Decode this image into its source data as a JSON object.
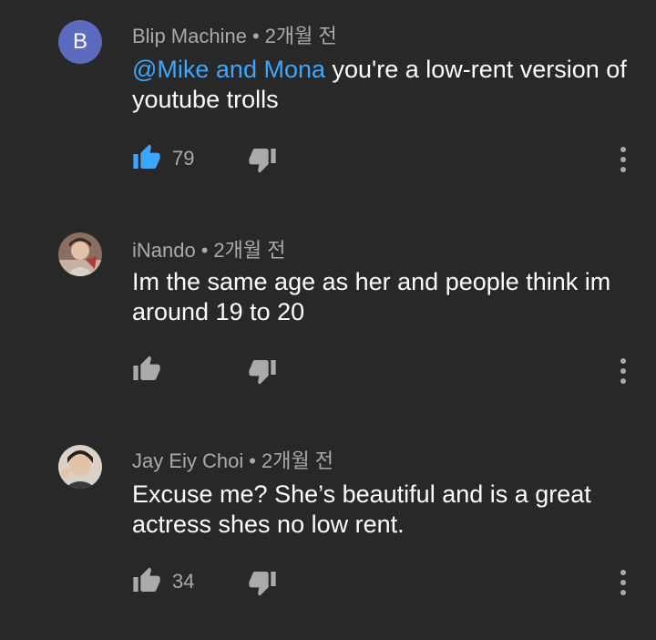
{
  "colors": {
    "background": "#282828",
    "mention": "#3ea6ff",
    "liked": "#3ea6ff",
    "muted": "#aaaaaa",
    "avatar_b": "#5c6bc0"
  },
  "comments": [
    {
      "author": "Blip Machine",
      "separator": "•",
      "time": "2개월 전",
      "avatar_letter": "B",
      "mention": "@Mike and Mona",
      "text": " you're a low-rent version of youtube trolls",
      "likes": "79",
      "liked": true,
      "like_icon": "thumbs-up-icon",
      "dislike_icon": "thumbs-down-icon",
      "menu_icon": "more-vert-icon"
    },
    {
      "author": "iNando",
      "separator": "•",
      "time": "2개월 전",
      "text": "Im the same age as her and people think im around 19 to 20",
      "likes": "",
      "liked": false,
      "like_icon": "thumbs-up-icon",
      "dislike_icon": "thumbs-down-icon",
      "menu_icon": "more-vert-icon"
    },
    {
      "author": "Jay Eiy Choi",
      "separator": "•",
      "time": "2개월 전",
      "text": "Excuse me? She’s beautiful and is a great actress shes no low rent.",
      "likes": "34",
      "liked": false,
      "like_icon": "thumbs-up-icon",
      "dislike_icon": "thumbs-down-icon",
      "menu_icon": "more-vert-icon"
    }
  ]
}
